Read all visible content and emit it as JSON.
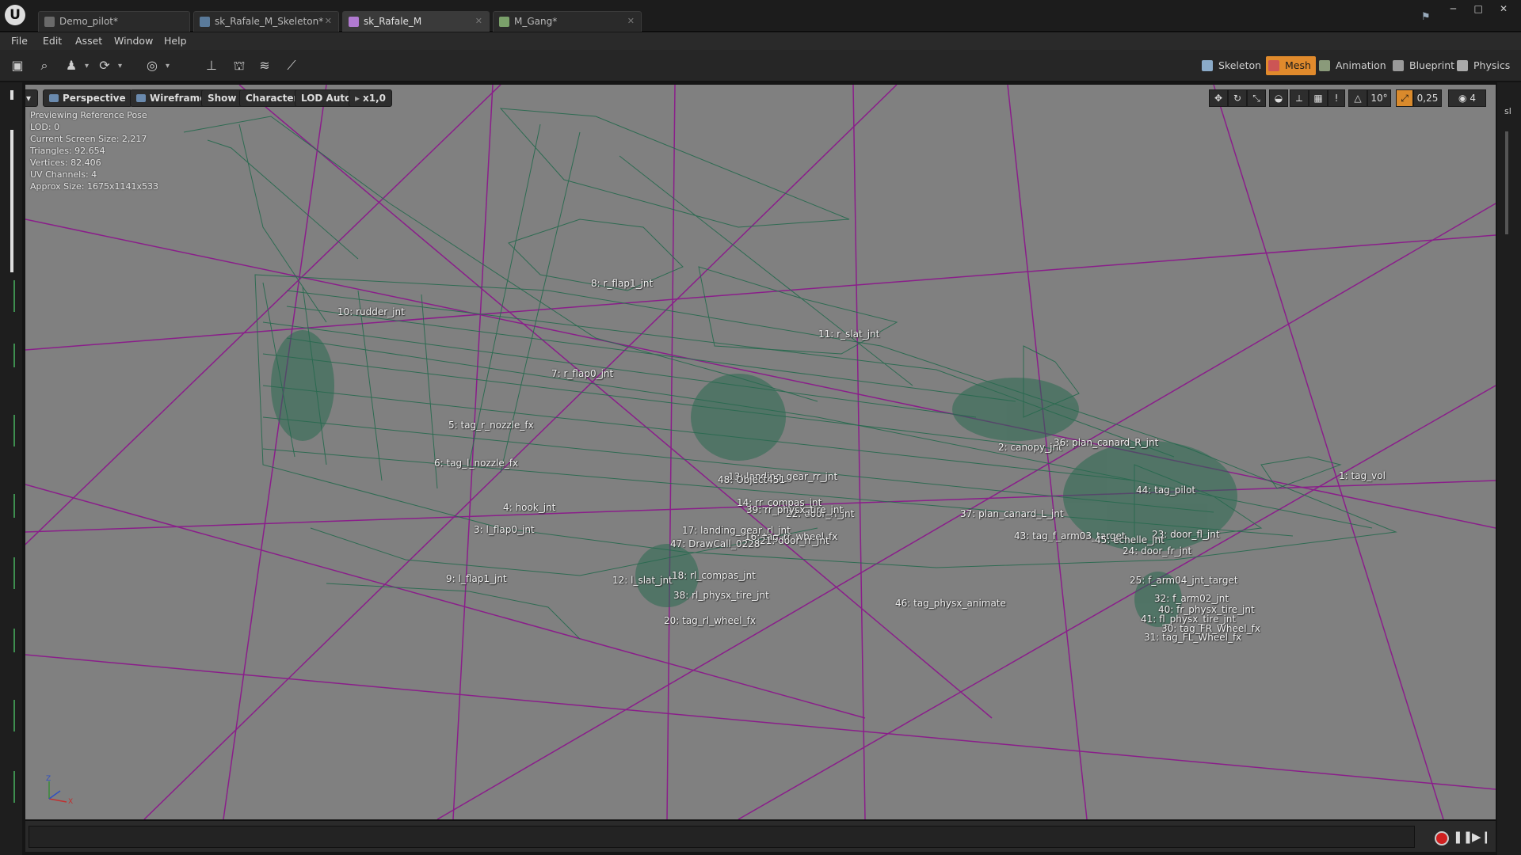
{
  "app": {
    "logo": "U"
  },
  "tabs": [
    {
      "label": "Demo_pilot*",
      "icon": "level-icon"
    },
    {
      "label": "sk_Rafale_M_Skeleton*",
      "icon": "skeleton-icon"
    },
    {
      "label": "sk_Rafale_M",
      "icon": "skeletal-mesh-icon"
    },
    {
      "label": "M_Gang*",
      "icon": "material-icon"
    }
  ],
  "window_controls": {
    "minimize": "─",
    "maximize": "□",
    "close": "✕"
  },
  "menu": [
    "File",
    "Edit",
    "Asset",
    "Window",
    "Help"
  ],
  "modes": [
    {
      "label": "Skeleton",
      "icon": "skeleton-mode-icon",
      "active": false
    },
    {
      "label": "Mesh",
      "icon": "mesh-mode-icon",
      "active": true
    },
    {
      "label": "Animation",
      "icon": "animation-mode-icon",
      "active": false
    },
    {
      "label": "Blueprint",
      "icon": "blueprint-mode-icon",
      "active": false
    },
    {
      "label": "Physics",
      "icon": "physics-mode-icon",
      "active": false
    }
  ],
  "viewport_toolbar": {
    "perspective": "Perspective",
    "wireframe": "Wireframe",
    "show": "Show",
    "character": "Character",
    "lod": "LOD Auto",
    "speed": "x1,0",
    "rotation_snap": "10°",
    "scale_snap": "0,25",
    "camera_speed": "4"
  },
  "stats": {
    "line1": "Previewing Reference Pose",
    "line2": "LOD: 0",
    "line3": "Current Screen Size: 2,217",
    "line4": "Triangles: 92.654",
    "line5": "Vertices: 82.406",
    "line6": "UV Channels: 4",
    "line7": "Approx Size: 1675x1141x533"
  },
  "bones": [
    "1: tag_vol",
    "2: canopy_jnt",
    "3: l_flap0_jnt",
    "4: hook_jnt",
    "5: tag_r_nozzle_fx",
    "6: tag_l_nozzle_fx",
    "7: r_flap0_jnt",
    "8: r_flap1_jnt",
    "9: l_flap1_jnt",
    "10: rudder_jnt",
    "11: r_slat_jnt",
    "12: l_slat_jnt",
    "13: landing_gear_rr_jnt",
    "14: rr_compas_jnt",
    "16: tag_rr_wheel_fx",
    "17: landing_gear_rl_jnt",
    "18: rl_compas_jnt",
    "20: tag_rl_wheel_fx",
    "21: door_rr_jnt",
    "22: door_rl_jnt",
    "23: door_fl_jnt",
    "24: door_fr_jnt",
    "25: f_arm04_jnt_target",
    "31: tag_FL_Wheel_fx",
    "32: f_arm02_jnt",
    "36: plan_canard_R_jnt",
    "37: plan_canard_L_jnt",
    "38: rl_physx_tire_jnt",
    "39: rr_physx_tire_jnt",
    "40: fr_physx_tire_jnt",
    "41: fl_physx_tire_jnt",
    "43: tag_f_arm03_target",
    "44: tag_pilot",
    "45: echelle_jnt",
    "46: tag_physx_animate",
    "47: DrawCall_0228",
    "48: Object451",
    "30: tag_FR_Wheel_fx"
  ]
}
